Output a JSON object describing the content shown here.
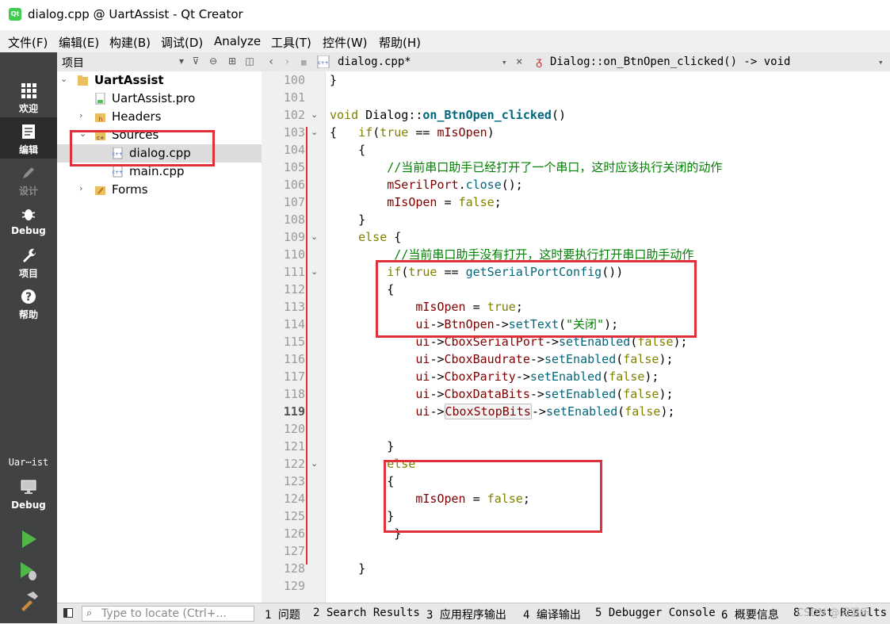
{
  "window": {
    "title": "dialog.cpp @ UartAssist - Qt Creator",
    "logo": "Qt"
  },
  "menu": [
    "文件(F)",
    "编辑(E)",
    "构建(B)",
    "调试(D)",
    "Analyze",
    "工具(T)",
    "控件(W)",
    "帮助(H)"
  ],
  "modes": [
    {
      "label": "欢迎",
      "icon": "grid-icon"
    },
    {
      "label": "编辑",
      "icon": "edit-document-icon"
    },
    {
      "label": "设计",
      "icon": "pen-icon"
    },
    {
      "label": "Debug",
      "icon": "bug-icon"
    },
    {
      "label": "项目",
      "icon": "wrench-icon"
    },
    {
      "label": "帮助",
      "icon": "help-icon"
    }
  ],
  "kit": {
    "target": "Uar⋯ist",
    "config": "Debug"
  },
  "project_panel": {
    "title": "项目"
  },
  "tree": {
    "project": "UartAssist",
    "pro": "UartAssist.pro",
    "headers": "Headers",
    "sources": "Sources",
    "dialog": "dialog.cpp",
    "main": "main.cpp",
    "forms": "Forms"
  },
  "editor": {
    "file_tab": "dialog.cpp*",
    "symbol": "Dialog::on_BtnOpen_clicked() -> void",
    "current_line": 119
  },
  "code_lines": [
    {
      "n": "100",
      "t": "}"
    },
    {
      "n": "101",
      "t": ""
    },
    {
      "n": "102",
      "t": "void Dialog::on_BtnOpen_clicked()"
    },
    {
      "n": "103",
      "t": "{   if(true == mIsOpen)"
    },
    {
      "n": "104",
      "t": "    {"
    },
    {
      "n": "105",
      "t": "        //当前串口助手已经打开了一个串口，这时应该执行关闭的动作"
    },
    {
      "n": "106",
      "t": "        mSerilPort.close();"
    },
    {
      "n": "107",
      "t": "        mIsOpen = false;"
    },
    {
      "n": "108",
      "t": "    }"
    },
    {
      "n": "109",
      "t": "    else {"
    },
    {
      "n": "110",
      "t": "         //当前串口助手没有打开，这时要执行打开串口助手动作"
    },
    {
      "n": "111",
      "t": "        if(true == getSerialPortConfig())"
    },
    {
      "n": "112",
      "t": "        {"
    },
    {
      "n": "113",
      "t": "            mIsOpen = true;"
    },
    {
      "n": "114",
      "t": "            ui->BtnOpen->setText(\"关闭\");"
    },
    {
      "n": "115",
      "t": "            ui->CboxSerialPort->setEnabled(false);"
    },
    {
      "n": "116",
      "t": "            ui->CboxBaudrate->setEnabled(false);"
    },
    {
      "n": "117",
      "t": "            ui->CboxParity->setEnabled(false);"
    },
    {
      "n": "118",
      "t": "            ui->CboxDataBits->setEnabled(false);"
    },
    {
      "n": "119",
      "t": "            ui->CboxStopBits->setEnabled(false);"
    },
    {
      "n": "120",
      "t": ""
    },
    {
      "n": "121",
      "t": "        }"
    },
    {
      "n": "122",
      "t": "        else"
    },
    {
      "n": "123",
      "t": "        {"
    },
    {
      "n": "124",
      "t": "            mIsOpen = false;"
    },
    {
      "n": "125",
      "t": "        }"
    },
    {
      "n": "126",
      "t": "         }"
    },
    {
      "n": "127",
      "t": ""
    },
    {
      "n": "128",
      "t": "    }"
    },
    {
      "n": "129",
      "t": ""
    }
  ],
  "status": {
    "locate_placeholder": "Type to locate (Ctrl+...",
    "tabs": [
      "1 问题",
      "2 Search Results",
      "3 应用程序输出",
      "4 编译输出",
      "5 Debugger Console",
      "6 概要信息",
      "8 Test Results"
    ]
  },
  "watermark": "CSDN @闫温乐",
  "colors": {
    "modebar": "#404244",
    "highlight_box": "#e0303a",
    "keyword": "#808000",
    "function": "#00677c",
    "member": "#800000",
    "comment": "#008000"
  }
}
